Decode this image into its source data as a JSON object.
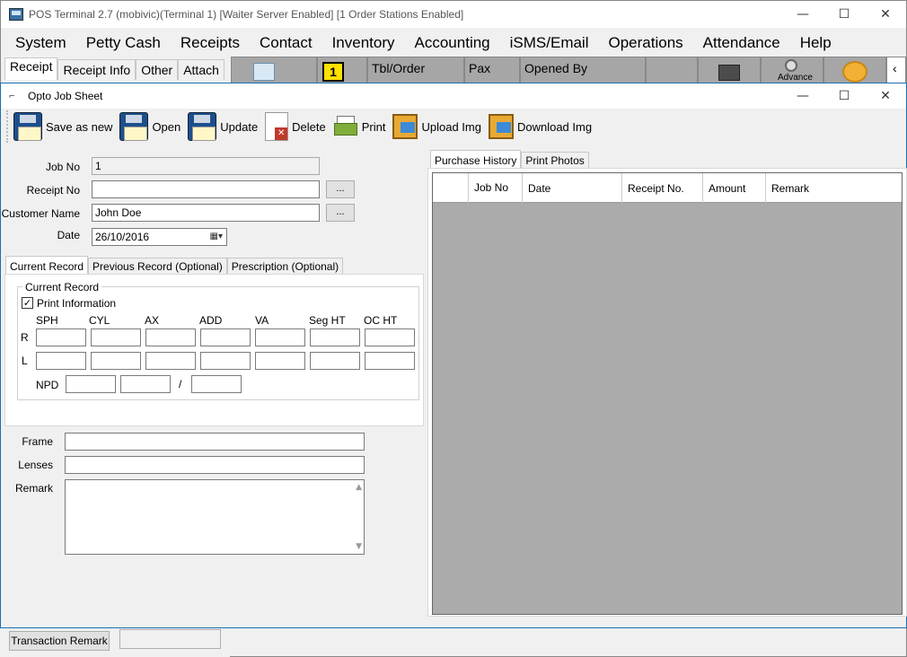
{
  "window": {
    "title": "POS Terminal 2.7 (mobivic)(Terminal 1) [Waiter Server Enabled] [1 Order Stations Enabled]",
    "min": "—",
    "max": "☐",
    "close": "✕"
  },
  "menu": [
    "System",
    "Petty Cash",
    "Receipts",
    "Contact",
    "Inventory",
    "Accounting",
    "iSMS/Email",
    "Operations",
    "Attendance",
    "Help"
  ],
  "left_tabs": [
    "Receipt",
    "Receipt Info",
    "Other",
    "Attach"
  ],
  "top_toolbar": {
    "badge": "1",
    "tbl_order": "Tbl/Order",
    "pax": "Pax",
    "opened_by": "Opened By",
    "advance": "Advance",
    "more": "‹"
  },
  "dialog": {
    "title": "Opto Job Sheet",
    "toolbar": {
      "save_as_new": "Save as new",
      "open": "Open",
      "update": "Update",
      "delete": "Delete",
      "print": "Print",
      "upload_img": "Upload Img",
      "download_img": "Download Img"
    },
    "form": {
      "job_no_label": "Job No",
      "job_no_value": "1",
      "receipt_no_label": "Receipt No",
      "receipt_no_value": "",
      "customer_name_label": "Customer Name",
      "customer_name_value": "John Doe",
      "date_label": "Date",
      "date_value": "26/10/2016",
      "browse": "..."
    },
    "record_tabs": [
      "Current Record",
      "Previous Record (Optional)",
      "Prescription (Optional)"
    ],
    "current_record": {
      "group_title": "Current Record",
      "print_info_label": "Print Information",
      "print_info_checked": true,
      "check_mark": "✓",
      "columns": [
        "SPH",
        "CYL",
        "AX",
        "ADD",
        "VA",
        "Seg HT",
        "OC HT"
      ],
      "row_r": "R",
      "row_l": "L",
      "npd_label": "NPD",
      "npd_sep": "/"
    },
    "frame_label": "Frame",
    "lenses_label": "Lenses",
    "remark_label": "Remark",
    "right_tabs": [
      "Purchase History",
      "Print Photos"
    ],
    "grid_columns": [
      "Job No",
      "Date",
      "Receipt No.",
      "Amount",
      "Remark"
    ]
  },
  "bottom": {
    "transaction_remark": "Transaction Remark"
  }
}
